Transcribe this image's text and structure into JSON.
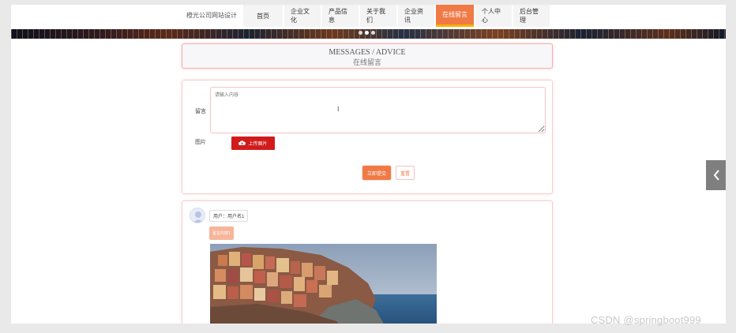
{
  "site": {
    "title": "橙光公司网站设计"
  },
  "nav": {
    "items": [
      {
        "label": "首页",
        "active": false
      },
      {
        "label": "企业文化",
        "active": false
      },
      {
        "label": "产品信息",
        "active": false
      },
      {
        "label": "关于我们",
        "active": false
      },
      {
        "label": "企业资讯",
        "active": false
      },
      {
        "label": "在线留言",
        "active": true
      },
      {
        "label": "个人中心",
        "active": false
      },
      {
        "label": "后台管理",
        "active": false
      }
    ]
  },
  "header": {
    "title_en": "MESSAGES / ADVICE",
    "title_cn": "在线留言"
  },
  "form": {
    "message_label": "留言",
    "message_placeholder": "请输入内容",
    "image_label": "图片",
    "upload_label": "上传图片",
    "submit_label": "立即提交",
    "reset_label": "重置"
  },
  "message": {
    "user_label": "用户：用户名1",
    "content_label": "留言内容1"
  },
  "watermark": "CSDN @springboot999",
  "colors": {
    "accent": "#f07a46",
    "upload": "#d11b1b",
    "border": "#f3b0b0"
  },
  "icons": {
    "upload": "cloud-upload-icon",
    "side": "chevron-left-icon",
    "avatar": "user-avatar-icon"
  }
}
